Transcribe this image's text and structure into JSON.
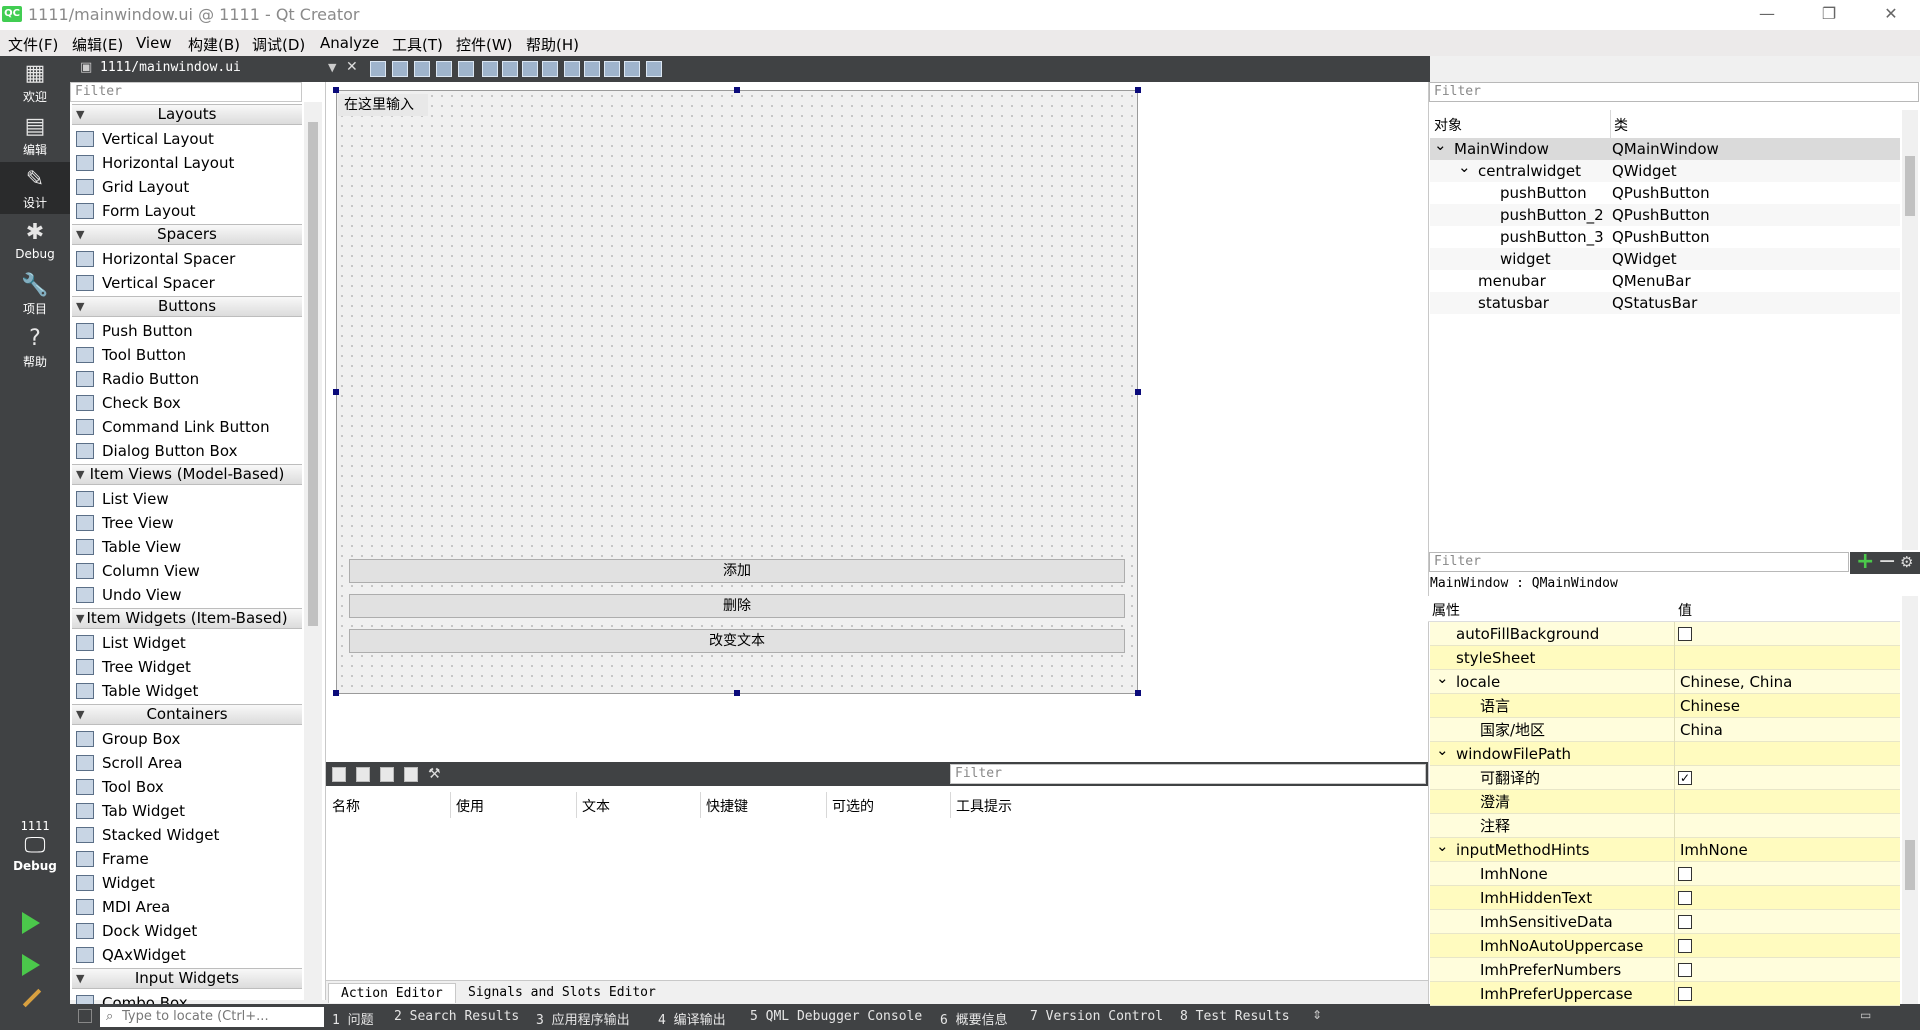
{
  "window": {
    "title": "1111/mainwindow.ui @ 1111 - Qt Creator",
    "logo": "QC"
  },
  "window_buttons": {
    "minimize": "—",
    "restore": "❐",
    "close": "✕"
  },
  "menu": [
    "文件(F)",
    "编辑(E)",
    "View",
    "构建(B)",
    "调试(D)",
    "Analyze",
    "工具(T)",
    "控件(W)",
    "帮助(H)"
  ],
  "modes": [
    {
      "label": "欢迎",
      "icon": "grid-icon",
      "glyph": "▦"
    },
    {
      "label": "编辑",
      "icon": "document-icon",
      "glyph": "▤"
    },
    {
      "label": "设计",
      "icon": "pencil-icon",
      "glyph": "✎"
    },
    {
      "label": "Debug",
      "icon": "bug-icon",
      "glyph": "✱"
    },
    {
      "label": "项目",
      "icon": "wrench-icon",
      "glyph": "🔧"
    },
    {
      "label": "帮助",
      "icon": "help-icon",
      "glyph": "?"
    }
  ],
  "kit": {
    "project": "1111",
    "label": "Debug",
    "glyph": "🖵"
  },
  "editor": {
    "file": "1111/mainwindow.ui",
    "close": "✕"
  },
  "widgetbox": {
    "filter_placeholder": "Filter",
    "categories": [
      {
        "name": "Layouts",
        "items": [
          "Vertical Layout",
          "Horizontal Layout",
          "Grid Layout",
          "Form Layout"
        ]
      },
      {
        "name": "Spacers",
        "items": [
          "Horizontal Spacer",
          "Vertical Spacer"
        ]
      },
      {
        "name": "Buttons",
        "items": [
          "Push Button",
          "Tool Button",
          "Radio Button",
          "Check Box",
          "Command Link Button",
          "Dialog Button Box"
        ]
      },
      {
        "name": "Item Views (Model-Based)",
        "items": [
          "List View",
          "Tree View",
          "Table View",
          "Column View",
          "Undo View"
        ]
      },
      {
        "name": "Item Widgets (Item-Based)",
        "items": [
          "List Widget",
          "Tree Widget",
          "Table Widget"
        ]
      },
      {
        "name": "Containers",
        "items": [
          "Group Box",
          "Scroll Area",
          "Tool Box",
          "Tab Widget",
          "Stacked Widget",
          "Frame",
          "Widget",
          "MDI Area",
          "Dock Widget",
          "QAxWidget"
        ]
      },
      {
        "name": "Input Widgets",
        "items": [
          "Combo Box"
        ]
      }
    ]
  },
  "form": {
    "menu_placeholder": "在这里输入",
    "buttons": [
      "添加",
      "删除",
      "改变文本"
    ]
  },
  "action_editor": {
    "filter_placeholder": "Filter",
    "columns": [
      "名称",
      "使用",
      "文本",
      "快捷键",
      "可选的",
      "工具提示"
    ],
    "tabs": [
      "Action Editor",
      "Signals and Slots Editor"
    ]
  },
  "status": {
    "locate_placeholder": "Type to locate (Ctrl+...",
    "items": [
      "1 问题",
      "2 Search Results",
      "3 应用程序输出",
      "4 编译输出",
      "5 QML Debugger Console",
      "6 概要信息",
      "7 Version Control",
      "8 Test Results"
    ]
  },
  "object_inspector": {
    "filter_placeholder": "Filter",
    "columns": [
      "对象",
      "类"
    ],
    "rows": [
      {
        "object": "MainWindow",
        "class": "QMainWindow",
        "expand": "v"
      },
      {
        "object": "centralwidget",
        "class": "QWidget",
        "expand": "v"
      },
      {
        "object": "pushButton",
        "class": "QPushButton",
        "expand": ""
      },
      {
        "object": "pushButton_2",
        "class": "QPushButton",
        "expand": ""
      },
      {
        "object": "pushButton_3",
        "class": "QPushButton",
        "expand": ""
      },
      {
        "object": "widget",
        "class": "QWidget",
        "expand": ""
      },
      {
        "object": "menubar",
        "class": "QMenuBar",
        "expand": ""
      },
      {
        "object": "statusbar",
        "class": "QStatusBar",
        "expand": ""
      }
    ]
  },
  "property_editor": {
    "filter_placeholder": "Filter",
    "class_label": "MainWindow : QMainWindow",
    "toolbar": {
      "add": "+",
      "remove": "−",
      "configure": "⚙"
    },
    "columns": [
      "属性",
      "值"
    ],
    "rows": [
      {
        "name": "autoFillBackground",
        "value": "",
        "checkbox": "off",
        "expand": ""
      },
      {
        "name": "styleSheet",
        "value": "",
        "checkbox": "",
        "expand": ""
      },
      {
        "name": "locale",
        "value": "Chinese, China",
        "checkbox": "",
        "expand": "v"
      },
      {
        "name": "语言",
        "value": "Chinese",
        "checkbox": "",
        "expand": ""
      },
      {
        "name": "国家/地区",
        "value": "China",
        "checkbox": "",
        "expand": ""
      },
      {
        "name": "windowFilePath",
        "value": "",
        "checkbox": "",
        "expand": "v"
      },
      {
        "name": "可翻译的",
        "value": "",
        "checkbox": "on",
        "expand": ""
      },
      {
        "name": "澄清",
        "value": "",
        "checkbox": "",
        "expand": ""
      },
      {
        "name": "注释",
        "value": "",
        "checkbox": "",
        "expand": ""
      },
      {
        "name": "inputMethodHints",
        "value": "ImhNone",
        "checkbox": "",
        "expand": "v"
      },
      {
        "name": "ImhNone",
        "value": "",
        "checkbox": "off",
        "expand": ""
      },
      {
        "name": "ImhHiddenText",
        "value": "",
        "checkbox": "off",
        "expand": ""
      },
      {
        "name": "ImhSensitiveData",
        "value": "",
        "checkbox": "off",
        "expand": ""
      },
      {
        "name": "ImhNoAutoUppercase",
        "value": "",
        "checkbox": "off",
        "expand": ""
      },
      {
        "name": "ImhPreferNumbers",
        "value": "",
        "checkbox": "off",
        "expand": ""
      },
      {
        "name": "ImhPreferUppercase",
        "value": "",
        "checkbox": "off",
        "expand": ""
      }
    ]
  }
}
